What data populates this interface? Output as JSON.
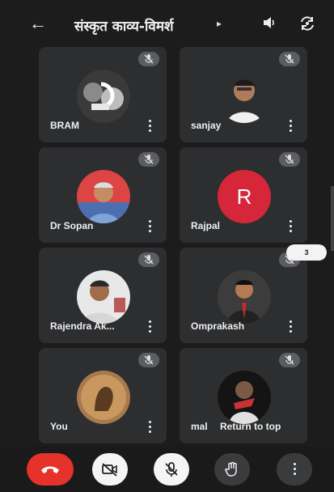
{
  "header": {
    "title": "संस्कृत काव्य-विमर्श",
    "icons": [
      "back-arrow-icon",
      "speaker-icon",
      "switch-camera-icon"
    ]
  },
  "participants": [
    {
      "name": "BRAM",
      "muted": true
    },
    {
      "name": "sanjay",
      "muted": true
    },
    {
      "name": "Dr Sopan",
      "muted": true
    },
    {
      "name": "Rajpal",
      "muted": true,
      "initial": "R",
      "avatar_color": "#d6263a"
    },
    {
      "name": "Rajendra Ak...",
      "muted": true
    },
    {
      "name": "Omprakash",
      "muted": true
    },
    {
      "name": "You",
      "muted": true
    },
    {
      "name": "mal",
      "muted": true
    }
  ],
  "overlay": {
    "return_to_top": "Return to top",
    "badge_count": "3"
  },
  "controls": [
    {
      "name": "end-call",
      "icon": "phone-hangup-icon",
      "color": "#e5322b"
    },
    {
      "name": "camera-off",
      "icon": "video-off-icon"
    },
    {
      "name": "mic-off",
      "icon": "mic-off-icon"
    },
    {
      "name": "raise-hand",
      "icon": "hand-icon"
    },
    {
      "name": "more-options",
      "icon": "more-vert-icon"
    }
  ]
}
